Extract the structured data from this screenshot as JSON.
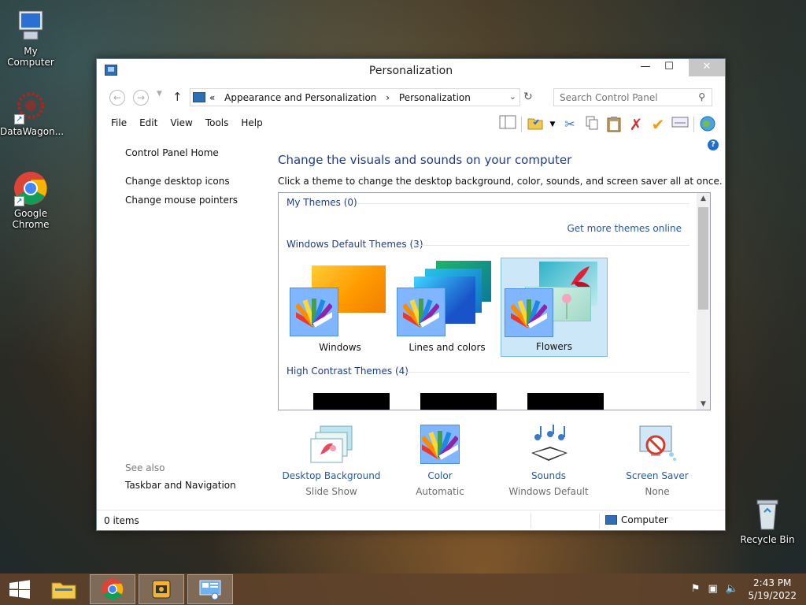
{
  "desktop": {
    "icons": [
      {
        "label": "My Computer"
      },
      {
        "label": "DataWagon..."
      },
      {
        "label": "Google Chrome"
      },
      {
        "label": "Recycle Bin"
      }
    ]
  },
  "window": {
    "title": "Personalization",
    "controls": {
      "minimize": "—",
      "maximize": "☐",
      "close": "✕"
    },
    "address": {
      "prefix": "«",
      "crumbs": [
        "Appearance and Personalization",
        "›",
        "Personalization"
      ]
    },
    "search": {
      "placeholder": "Search Control Panel"
    },
    "menu": [
      "File",
      "Edit",
      "View",
      "Tools",
      "Help"
    ],
    "left_links": [
      "Control Panel Home",
      "Change desktop icons",
      "Change mouse pointers"
    ],
    "see_also": {
      "heading": "See also",
      "link": "Taskbar and Navigation"
    },
    "main": {
      "title": "Change the visuals and sounds on your computer",
      "subtitle": "Click a theme to change the desktop background, color, sounds, and screen saver all at once.",
      "groups": {
        "my_themes": "My Themes (0)",
        "get_more": "Get more themes online",
        "default_themes": "Windows Default Themes (3)",
        "high_contrast": "High Contrast Themes (4)"
      },
      "themes": [
        {
          "name": "Windows",
          "selected": false
        },
        {
          "name": "Lines and colors",
          "selected": false
        },
        {
          "name": "Flowers",
          "selected": true
        }
      ]
    },
    "settings": [
      {
        "label": "Desktop Background",
        "value": "Slide Show"
      },
      {
        "label": "Color",
        "value": "Automatic"
      },
      {
        "label": "Sounds",
        "value": "Windows Default"
      },
      {
        "label": "Screen Saver",
        "value": "None"
      }
    ],
    "status": {
      "items": "0 items",
      "location": "Computer"
    }
  },
  "taskbar": {
    "time": "2:43 PM",
    "date": "5/19/2022"
  },
  "colors": {
    "link": "#1e5ab4",
    "heading": "#1e3c8c",
    "selection": "#cce8f8"
  }
}
